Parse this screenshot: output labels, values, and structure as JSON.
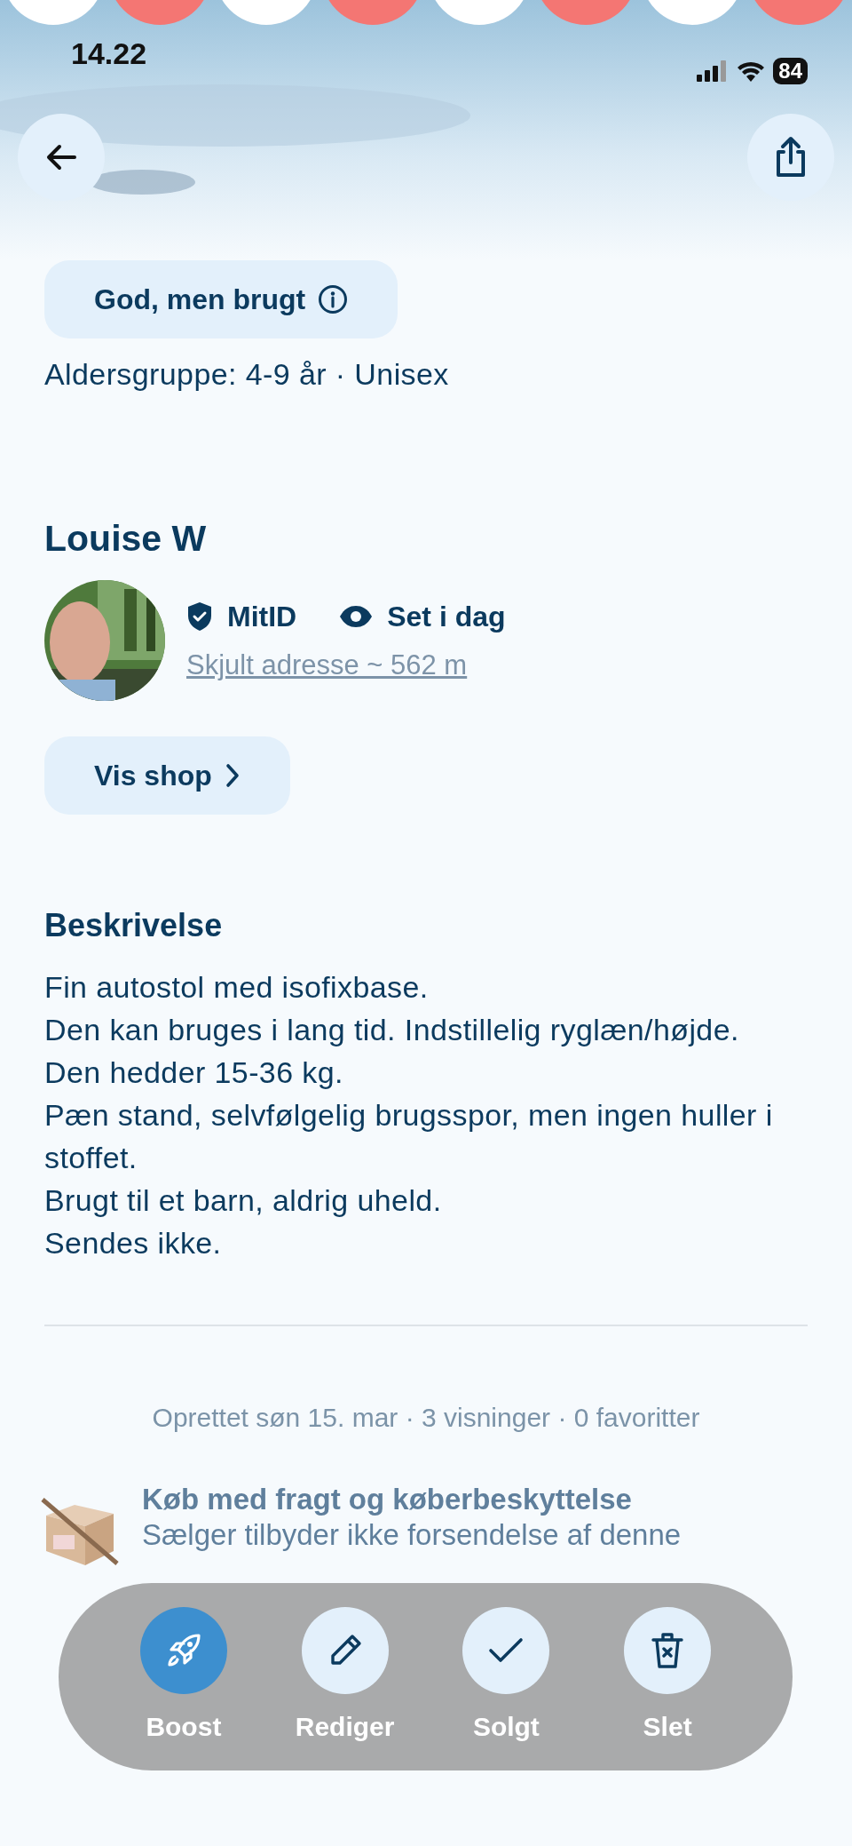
{
  "status_bar": {
    "time": "14.22",
    "battery": "84"
  },
  "condition": {
    "label": "God, men brugt"
  },
  "age_group": "Aldersgruppe: 4-9 år · Unisex",
  "seller": {
    "name": "Louise W",
    "badges": [
      {
        "kind": "verified",
        "label": "MitID"
      },
      {
        "kind": "seen",
        "label": "Set i dag"
      }
    ],
    "location_link": "Skjult adresse ~ 562 m",
    "shop_button": "Vis shop"
  },
  "description": {
    "heading": "Beskrivelse",
    "text": "Fin autostol med isofixbase.\nDen kan bruges i lang tid. Indstillelig ryglæn/højde.\nDen hedder 15-36 kg.\nPæn stand, selvfølgelig brugsspor, men ingen huller i stoffet.\nBrugt til et barn, aldrig uheld.\nSendes ikke."
  },
  "meta": "Oprettet søn 15. mar · 3 visninger · 0 favoritter",
  "shipping": {
    "title": "Køb med fragt og køberbeskyttelse",
    "subtitle": "Sælger tilbyder ikke forsendelse af denne"
  },
  "actions": [
    {
      "kind": "boost",
      "label": "Boost",
      "selected": true
    },
    {
      "kind": "edit",
      "label": "Rediger",
      "selected": false
    },
    {
      "kind": "sold",
      "label": "Solgt",
      "selected": false
    },
    {
      "kind": "delete",
      "label": "Slet",
      "selected": false
    }
  ]
}
